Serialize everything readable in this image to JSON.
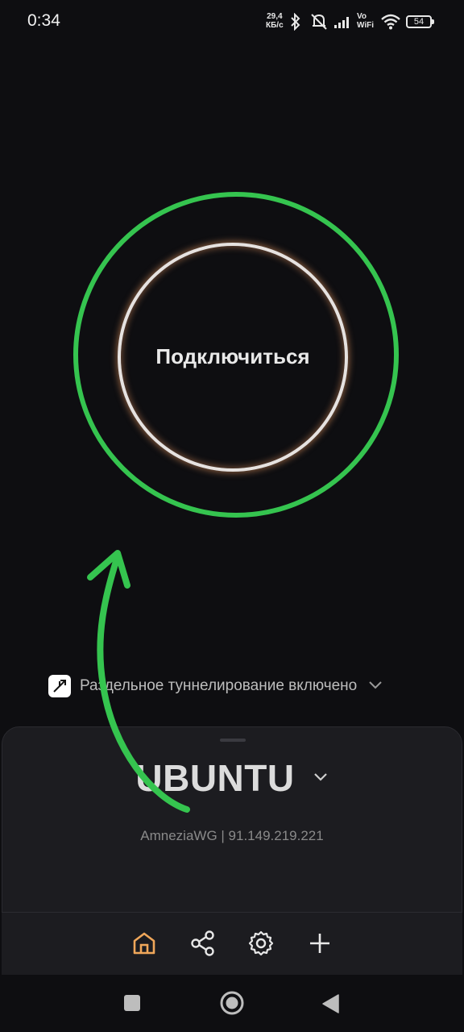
{
  "status_bar": {
    "time": "0:34",
    "speed_value": "29,4",
    "speed_unit": "КБ/с",
    "vowifi_top": "Vo",
    "vowifi_bottom": "WiFi",
    "battery": "54"
  },
  "connect": {
    "button_label": "Подключиться",
    "ring_color": "#35c44f"
  },
  "split_tunneling": {
    "label": "Раздельное туннелирование включено"
  },
  "server": {
    "name": "UBUNTU",
    "info": "AmneziaWG | 91.149.219.221"
  },
  "tabs": [
    {
      "icon": "home-icon",
      "active": true,
      "color": "#f0a75a"
    },
    {
      "icon": "share-icon",
      "active": false
    },
    {
      "icon": "gear-icon",
      "active": false
    },
    {
      "icon": "plus-icon",
      "active": false
    }
  ],
  "annotation": {
    "arrow_color": "#35c44f"
  }
}
